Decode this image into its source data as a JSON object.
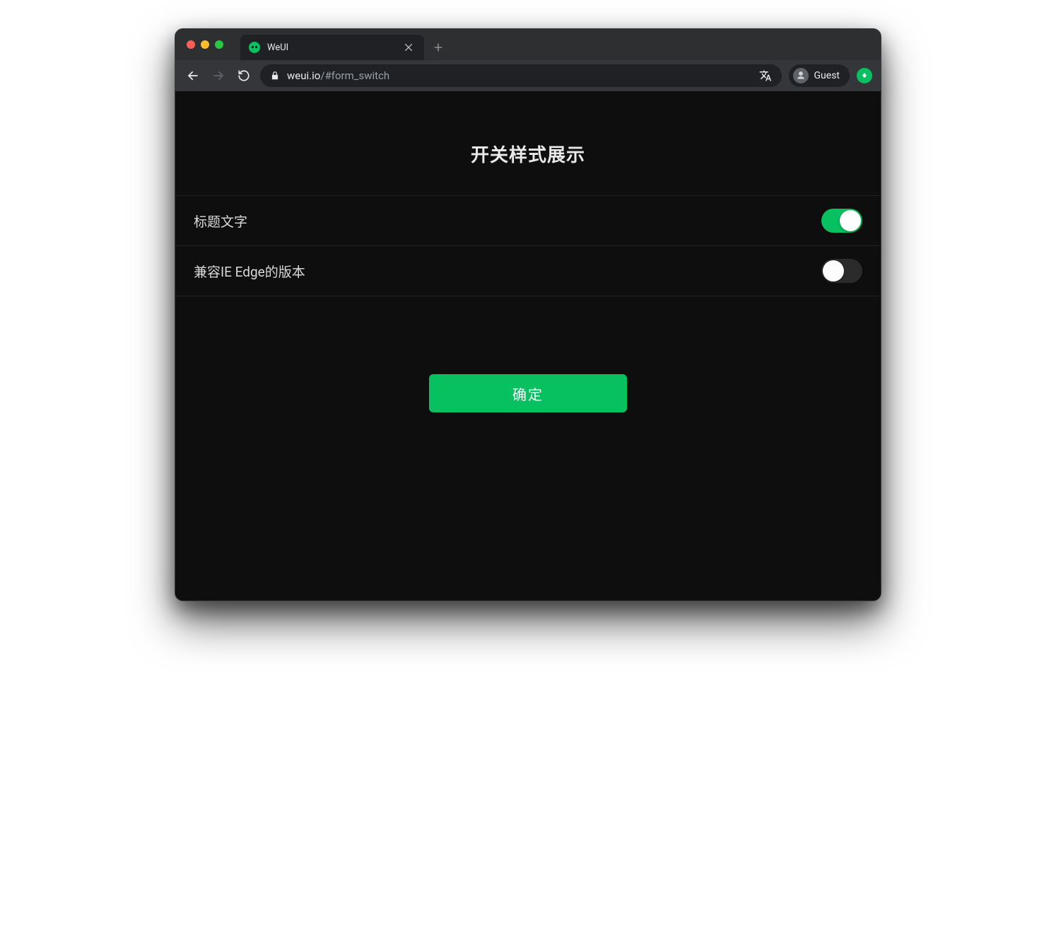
{
  "browser": {
    "tab_title": "WeUI",
    "url_host": "weui.io",
    "url_path": "/#form_switch",
    "profile_label": "Guest"
  },
  "page": {
    "title": "开关样式展示",
    "cells": [
      {
        "label": "标题文字",
        "on": true
      },
      {
        "label": "兼容IE Edge的版本",
        "on": false
      }
    ],
    "confirm_label": "确定"
  },
  "colors": {
    "accent": "#07c160"
  }
}
